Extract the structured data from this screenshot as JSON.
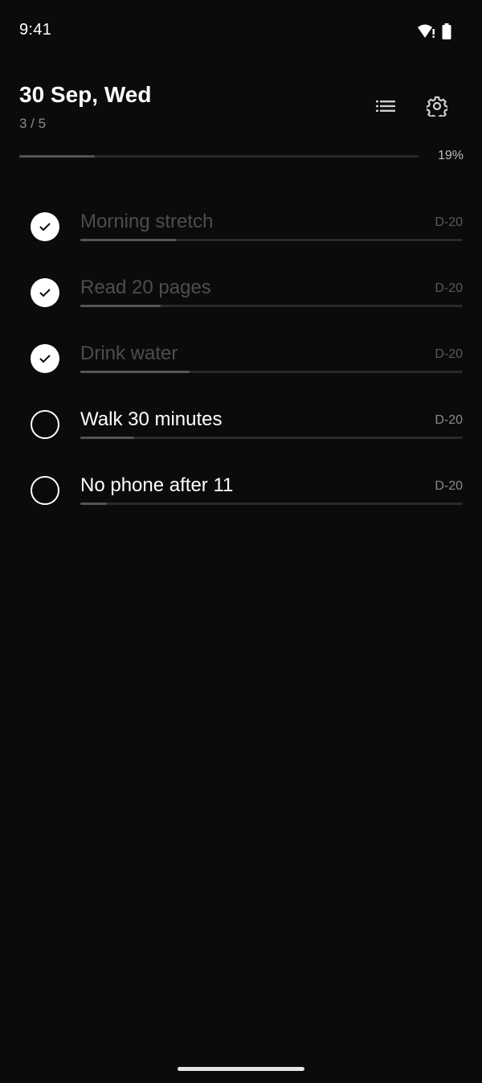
{
  "status_bar": {
    "time": "9:41",
    "icons": [
      "wifi-alert-icon",
      "battery-icon"
    ]
  },
  "header": {
    "date": "30 Sep, Wed",
    "done_count": "3 / 5",
    "actions": [
      "list-icon",
      "gear-icon"
    ]
  },
  "overall_progress": {
    "percent_label": "19%",
    "fraction": 0.19
  },
  "habits": [
    {
      "name": "Morning stretch",
      "dday": "D-20",
      "done": true,
      "progress": 0.25
    },
    {
      "name": "Read 20 pages",
      "dday": "D-20",
      "done": true,
      "progress": 0.21
    },
    {
      "name": "Drink water",
      "dday": "D-20",
      "done": true,
      "progress": 0.285
    },
    {
      "name": "Walk 30 minutes",
      "dday": "D-20",
      "done": false,
      "progress": 0.14
    },
    {
      "name": "No phone after 11",
      "dday": "D-20",
      "done": false,
      "progress": 0.07
    }
  ],
  "colors": {
    "background": "#0b0b0b",
    "text_primary": "#ffffff",
    "text_done": "#4d4d4d",
    "track": "#2a2a2a",
    "track_fill": "#555555"
  }
}
